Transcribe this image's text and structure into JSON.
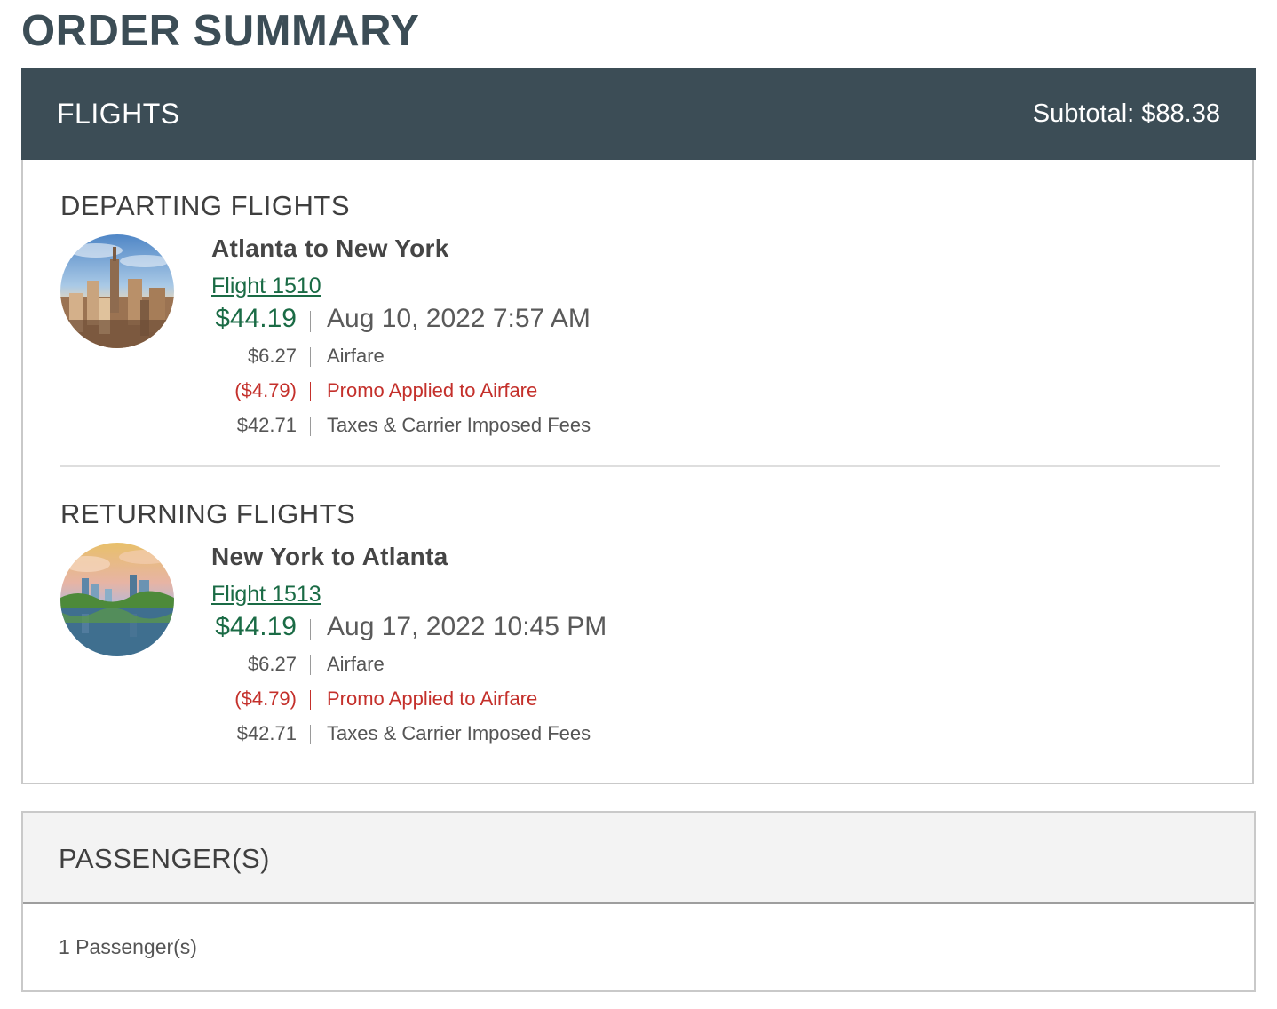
{
  "page_title": "ORDER SUMMARY",
  "flights": {
    "header_title": "FLIGHTS",
    "subtotal": "Subtotal: $88.38",
    "departing": {
      "section_title": "DEPARTING FLIGHTS",
      "image": "new-york-skyline",
      "route": "Atlanta to New York",
      "flight_link": "Flight 1510",
      "total_price": "$44.19",
      "datetime": "Aug 10, 2022 7:57 AM",
      "breakdown": [
        {
          "amount": "$6.27",
          "label": "Airfare",
          "type": "normal"
        },
        {
          "amount": "($4.79)",
          "label": "Promo Applied to Airfare",
          "type": "promo"
        },
        {
          "amount": "$42.71",
          "label": "Taxes & Carrier Imposed Fees",
          "type": "normal"
        }
      ]
    },
    "returning": {
      "section_title": "RETURNING FLIGHTS",
      "image": "atlanta-skyline",
      "route": "New York to Atlanta",
      "flight_link": "Flight 1513",
      "total_price": "$44.19",
      "datetime": "Aug 17, 2022 10:45 PM",
      "breakdown": [
        {
          "amount": "$6.27",
          "label": "Airfare",
          "type": "normal"
        },
        {
          "amount": "($4.79)",
          "label": "Promo Applied to Airfare",
          "type": "promo"
        },
        {
          "amount": "$42.71",
          "label": "Taxes & Carrier Imposed Fees",
          "type": "normal"
        }
      ]
    }
  },
  "passengers": {
    "header_title": "PASSENGER(S)",
    "count_text": "1 Passenger(s)"
  },
  "colors": {
    "header_bg": "#3c4d56",
    "price_green": "#1a6b45",
    "promo_red": "#c4302b"
  }
}
